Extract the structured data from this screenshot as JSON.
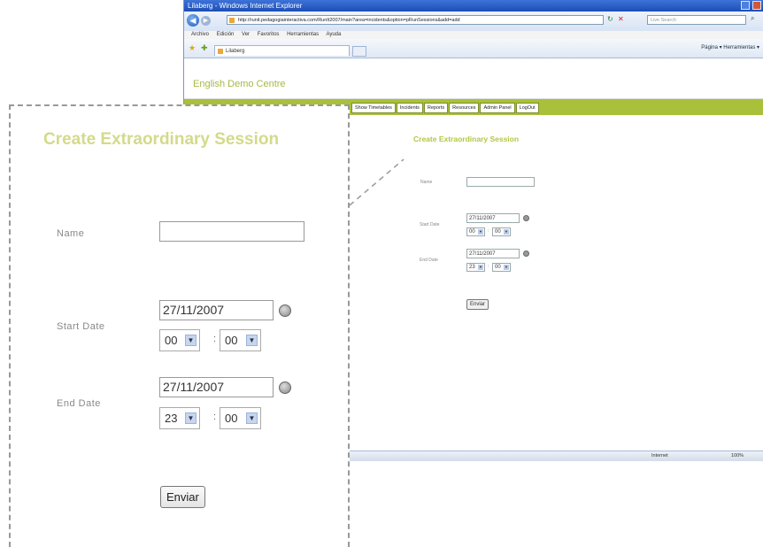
{
  "browser": {
    "window_title": "Lilaberg - Windows Internet Explorer",
    "address": "http://runit.pedagogiainteractiva.com/RunIt2007/main?area=incidents&option=pRunSessions&add=add",
    "search_placeholder": "Live Search",
    "menu": [
      "Archivo",
      "Edición",
      "Ver",
      "Favoritos",
      "Herramientas",
      "Ayuda"
    ],
    "tab_title": "Lilaberg",
    "command_bar": "Página ▾  Herramientas ▾",
    "status_zone": "Internet",
    "status_zoom": "100%"
  },
  "site": {
    "title": "English Demo Centre",
    "nav": [
      "Show Timetables",
      "Incidents",
      "Reports",
      "Resources",
      "Admin Panel",
      "LogOut"
    ]
  },
  "form": {
    "heading": "Create Extraordinary Session",
    "name_label": "Name",
    "name_value": "",
    "start_label": "Start Date",
    "start_date": "27/11/2007",
    "start_hour": "00",
    "start_minute": "00",
    "end_label": "End Date",
    "end_date": "27/11/2007",
    "end_hour": "23",
    "end_minute": "00",
    "time_separator": ":",
    "submit_label": "Enviar"
  },
  "colors": {
    "accent_green": "#a9c03a",
    "heading_green": "#b5c546",
    "ie_blue": "#1c4fb6"
  }
}
